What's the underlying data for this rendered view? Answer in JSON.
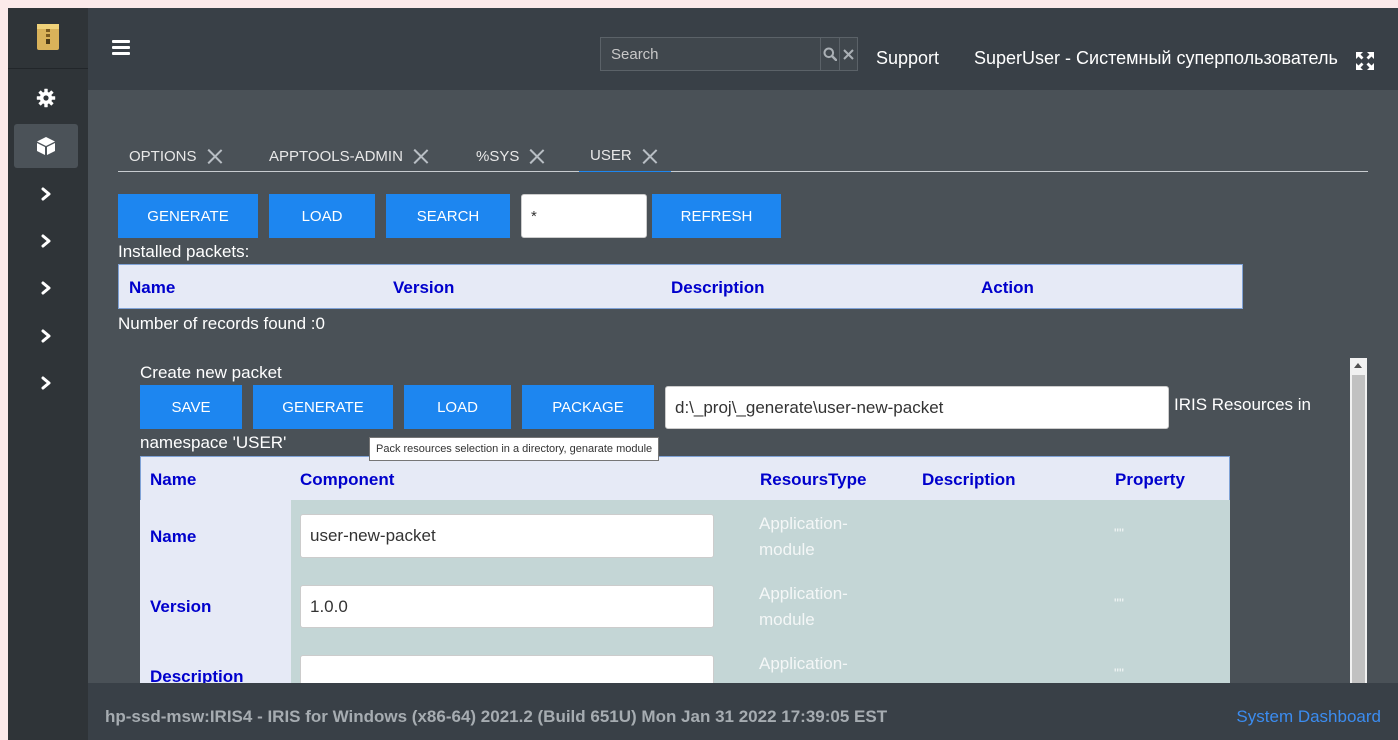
{
  "header": {
    "search_placeholder": "Search",
    "support_label": "Support",
    "user_label": "SuperUser - Системный суперпользователь"
  },
  "sidebar": {
    "items": [
      {
        "icon": "gear-icon"
      },
      {
        "icon": "cube-icon",
        "active": true
      },
      {
        "icon": "chevron-right-icon"
      },
      {
        "icon": "chevron-right-icon"
      },
      {
        "icon": "chevron-right-icon"
      },
      {
        "icon": "chevron-right-icon"
      },
      {
        "icon": "chevron-right-icon"
      }
    ]
  },
  "tabs": [
    {
      "label": "OPTIONS"
    },
    {
      "label": "APPTOOLS-ADMIN"
    },
    {
      "label": "%SYS"
    },
    {
      "label": "USER",
      "active": true
    }
  ],
  "toolbar": {
    "generate_label": "GENERATE",
    "load_label": "LOAD",
    "search_label": "SEARCH",
    "filter_value": "*",
    "refresh_label": "REFRESH"
  },
  "installed": {
    "title": "Installed packets:",
    "columns": [
      "Name",
      "Version",
      "Description",
      "Action"
    ],
    "records_text": "Number of records found :0"
  },
  "create": {
    "title": "Create new packet",
    "save_label": "SAVE",
    "generate_label": "GENERATE",
    "load_label": "LOAD",
    "package_label": "PACKAGE",
    "path_value": "d:\\_proj\\_generate\\user-new-packet",
    "resources_text_1": "IRIS Resources in",
    "resources_text_2": "namespace 'USER'",
    "tooltip": "Pack resources selection in a directory, genarate module",
    "columns": [
      "Name",
      "Component",
      "ResoursType",
      "Description",
      "Property"
    ],
    "rows": [
      {
        "name": "Name",
        "component": "user-new-packet",
        "type_line1": "Application-",
        "type_line2": "module",
        "property": "\"\""
      },
      {
        "name": "Version",
        "component": "1.0.0",
        "type_line1": "Application-",
        "type_line2": "module",
        "property": "\"\""
      },
      {
        "name": "Description",
        "component": "",
        "type_line1": "Application-",
        "type_line2": "",
        "property": "\"\""
      }
    ]
  },
  "footer": {
    "info": "hp-ssd-msw:IRIS4 - IRIS for Windows (x86-64) 2021.2 (Build 651U) Mon Jan 31 2022 17:39:05 EST",
    "dashboard_link": "System Dashboard"
  },
  "colors": {
    "accent": "#1d86f0",
    "header_bg": "#394047",
    "content_bg": "#4a5157",
    "table_header_bg": "#e6eaf6",
    "table_text": "#0000cc"
  }
}
